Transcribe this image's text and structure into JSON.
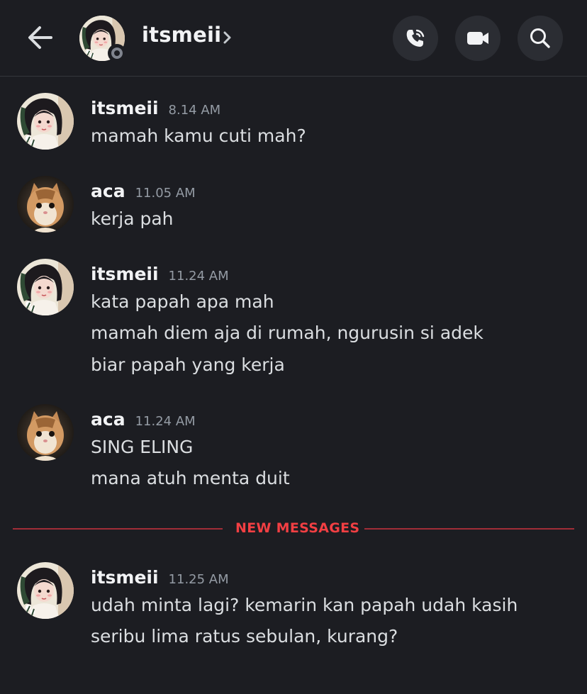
{
  "header": {
    "title": "itsmeii",
    "icons": {
      "back": "arrow-left-icon",
      "chevron": "chevron-right-icon",
      "call": "phone-call-icon",
      "video": "video-camera-icon",
      "search": "search-icon"
    }
  },
  "messages": [
    {
      "author": "itsmeii",
      "time": "8.14 AM",
      "avatar": "girl-avatar",
      "lines": [
        "mamah kamu cuti mah?"
      ]
    },
    {
      "author": "aca",
      "time": "11.05 AM",
      "avatar": "cat-avatar",
      "lines": [
        "kerja pah"
      ]
    },
    {
      "author": "itsmeii",
      "time": "11.24 AM",
      "avatar": "girl-avatar",
      "lines": [
        "kata papah apa mah",
        "mamah diem aja di rumah, ngurusin si adek",
        "biar papah yang kerja"
      ]
    },
    {
      "author": "aca",
      "time": "11.24 AM",
      "avatar": "cat-avatar",
      "lines": [
        "SING ELING",
        "mana atuh menta duit"
      ]
    },
    {
      "author": "itsmeii",
      "time": "11.25 AM",
      "avatar": "girl-avatar",
      "lines": [
        "udah minta lagi? kemarin kan papah udah kasih",
        "seribu lima ratus sebulan, kurang?"
      ]
    }
  ],
  "divider": {
    "label": "NEW MESSAGES"
  },
  "colors": {
    "background": "#1c1d22",
    "new_messages_red": "#f23f43",
    "button_bg": "#2b2d33",
    "timestamp": "#949ba4"
  }
}
